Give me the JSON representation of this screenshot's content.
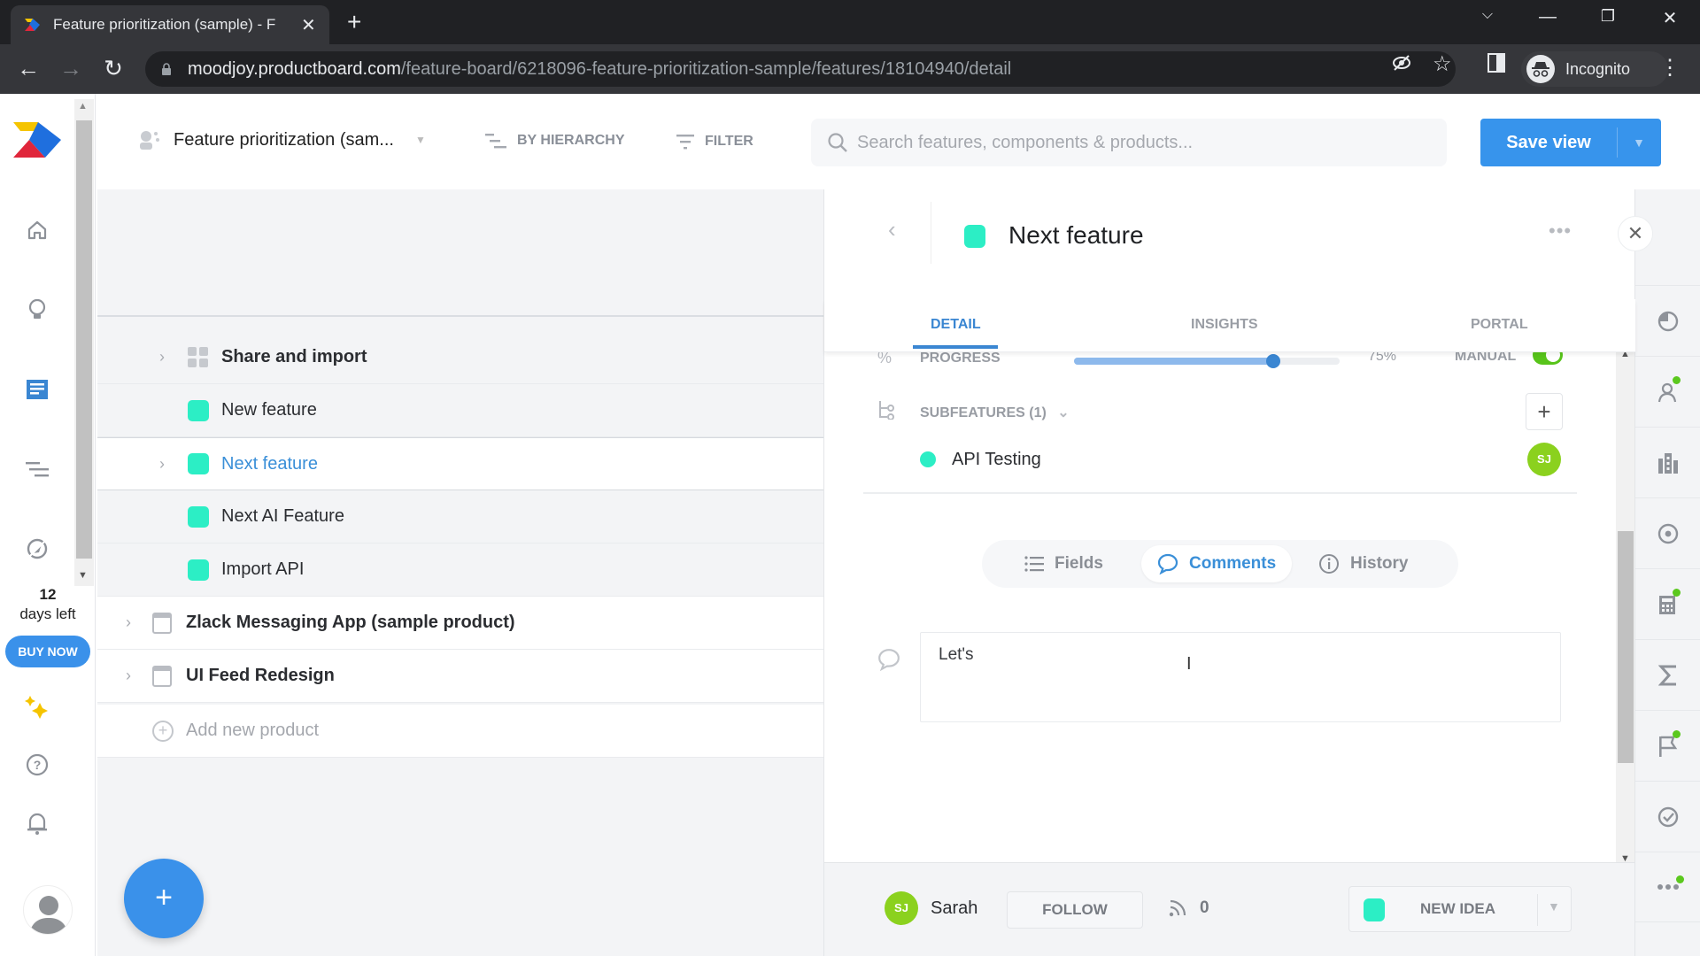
{
  "browser": {
    "tab_title": "Feature prioritization (sample) - F",
    "url_host": "moodjoy.productboard.com",
    "url_path": "/feature-board/6218096-feature-prioritization-sample/features/18104940/detail",
    "profile_label": "Incognito"
  },
  "leftnav": {
    "items": [
      {
        "icon": "home-icon"
      },
      {
        "icon": "lightbulb-icon"
      },
      {
        "icon": "features-board-icon",
        "active": true
      },
      {
        "icon": "roadmap-icon"
      },
      {
        "icon": "portal-icon"
      }
    ],
    "trial_days": "12",
    "trial_label": "days left",
    "buy_now_label": "BUY NOW"
  },
  "toolbar": {
    "board_name": "Feature prioritization (sam...",
    "group_by_label": "BY HIERARCHY",
    "filter_label": "FILTER",
    "search_placeholder": "Search features, components & products...",
    "save_view_label": "Save view"
  },
  "tree": {
    "rows": [
      {
        "label": "Share and import",
        "type": "component",
        "expandable": true
      },
      {
        "label": "New feature",
        "type": "feature",
        "expandable": false
      },
      {
        "label": "Next feature",
        "type": "feature",
        "expandable": true,
        "selected": true
      },
      {
        "label": "Next AI Feature",
        "type": "feature",
        "expandable": false
      },
      {
        "label": "Import API",
        "type": "feature",
        "expandable": false
      },
      {
        "label": "Zlack Messaging App (sample product)",
        "type": "product",
        "expandable": true
      },
      {
        "label": "UI Feed Redesign",
        "type": "product",
        "expandable": true
      }
    ],
    "add_product_label": "Add new product"
  },
  "detail": {
    "title": "Next feature",
    "status_color": "#2ceec5",
    "tabs": [
      {
        "label": "DETAIL",
        "active": true
      },
      {
        "label": "INSIGHTS",
        "active": false
      },
      {
        "label": "PORTAL",
        "active": false
      }
    ],
    "progress": {
      "label": "PROGRESS",
      "value": 0.75,
      "value_text": "75%",
      "mode_label": "MANUAL",
      "manual_enabled": true
    },
    "subfeatures": {
      "label": "SUBFEATURES (1)",
      "items": [
        {
          "label": "API Testing",
          "owner_initials": "SJ"
        }
      ]
    },
    "segments": [
      {
        "label": "Fields",
        "active": false
      },
      {
        "label": "Comments",
        "active": true
      },
      {
        "label": "History",
        "active": false
      }
    ],
    "comment_draft": "Let's"
  },
  "footer": {
    "owner_initials": "SJ",
    "owner_name": "Sarah",
    "follow_label": "FOLLOW",
    "insights_count": "0",
    "status_label": "NEW IDEA"
  },
  "colors": {
    "accent": "#3a91ea",
    "feature_status": "#2ceec5",
    "avatar_green": "#8bd11e",
    "indicator_green": "#5bc81e"
  }
}
